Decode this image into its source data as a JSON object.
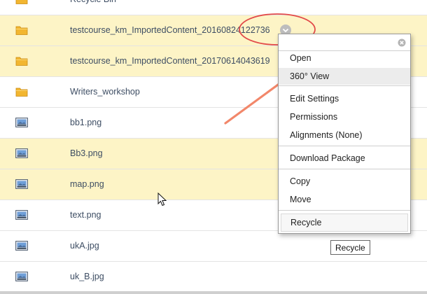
{
  "files": [
    {
      "name": "Recycle Bin",
      "type": "folder",
      "highlight": false
    },
    {
      "name": "testcourse_km_ImportedContent_20160824122736",
      "type": "folder",
      "highlight": true,
      "full": true
    },
    {
      "name": "testcourse_km_ImportedContent_20170614043619",
      "type": "folder",
      "highlight": true
    },
    {
      "name": "Writers_workshop",
      "type": "folder",
      "highlight": false
    },
    {
      "name": "bb1.png",
      "type": "image",
      "highlight": false
    },
    {
      "name": "Bb3.png",
      "type": "image",
      "highlight": true
    },
    {
      "name": "map.png",
      "type": "image",
      "highlight": true
    },
    {
      "name": "text.png",
      "type": "image",
      "highlight": false
    },
    {
      "name": "ukA.jpg",
      "type": "image",
      "highlight": false
    },
    {
      "name": "uk_B.jpg",
      "type": "image",
      "highlight": false
    }
  ],
  "menu": {
    "items": [
      {
        "label": "Open",
        "id": "open"
      },
      {
        "label": "360° View",
        "id": "360-view"
      },
      {
        "label": "Edit Settings",
        "id": "edit-settings"
      },
      {
        "label": "Permissions",
        "id": "permissions"
      },
      {
        "label": "Alignments (None)",
        "id": "alignments"
      },
      {
        "label": "Download Package",
        "id": "download-package"
      },
      {
        "label": "Copy",
        "id": "copy"
      },
      {
        "label": "Move",
        "id": "move"
      },
      {
        "label": "Recycle",
        "id": "recycle"
      }
    ],
    "selected": "360-view",
    "active": "recycle"
  },
  "tooltip": {
    "text": "Recycle"
  },
  "colors": {
    "row_highlight": "#fdf4c6",
    "annotation_arrow": "#f2876a",
    "annotation_circle": "#e24a4a",
    "folder": "#f2b630"
  }
}
